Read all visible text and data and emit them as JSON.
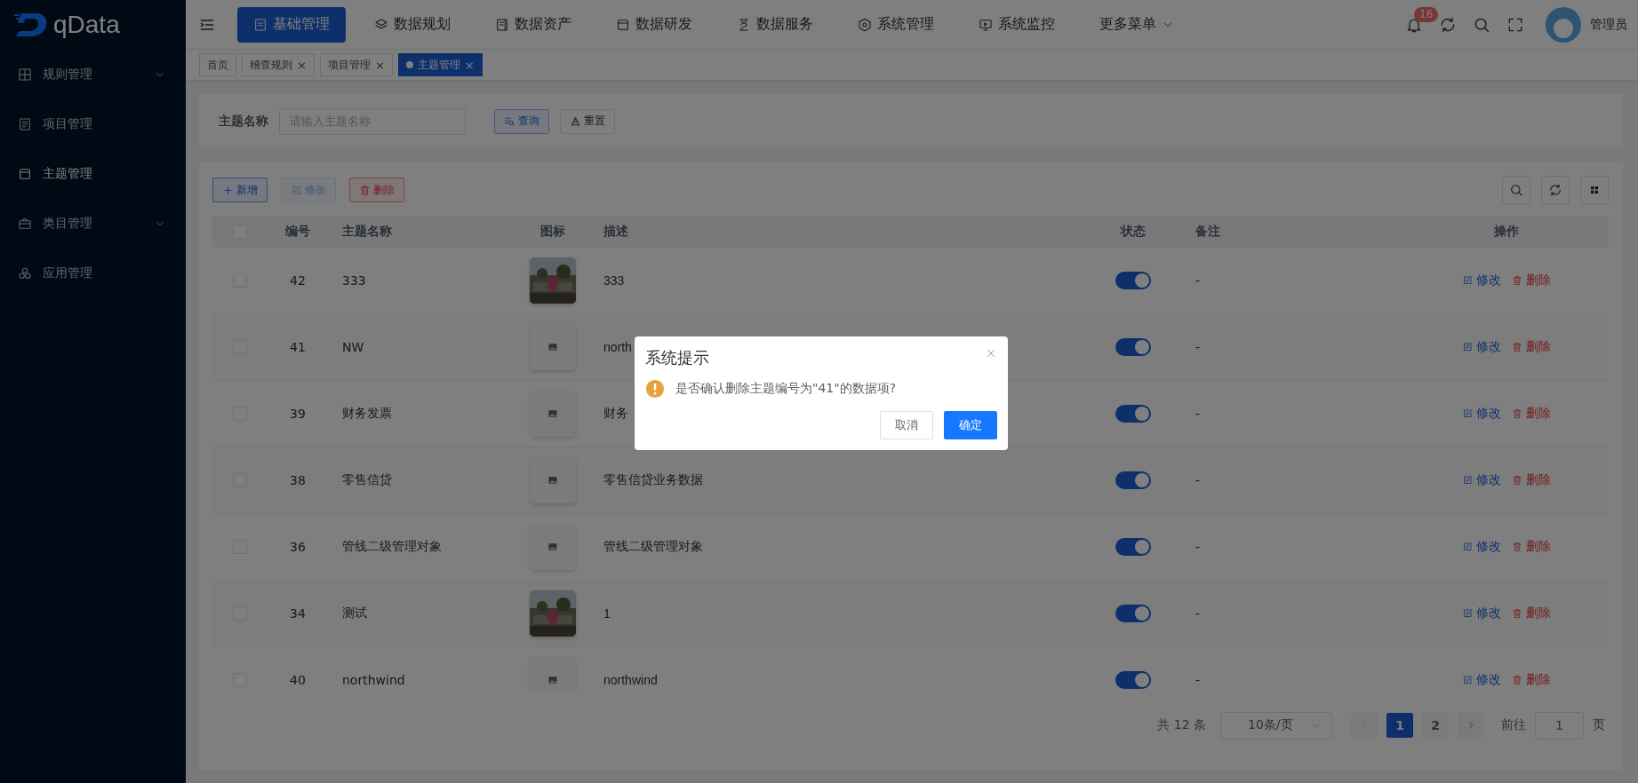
{
  "logo": {
    "text": "qData"
  },
  "top_menu": [
    {
      "label": "基础管理",
      "kind": "link",
      "selected": true
    },
    {
      "label": "数据规划",
      "kind": "link",
      "selected": false
    },
    {
      "label": "数据资产",
      "kind": "link",
      "selected": false
    },
    {
      "label": "数据研发",
      "kind": "link",
      "selected": false
    },
    {
      "label": "数据服务",
      "kind": "link",
      "selected": false
    },
    {
      "label": "系统管理",
      "kind": "link",
      "selected": false
    },
    {
      "label": "系统监控",
      "kind": "link",
      "selected": false
    },
    {
      "label": "更多菜单",
      "kind": "dropdown",
      "selected": false
    }
  ],
  "header": {
    "notification_count": "16",
    "user": "管理员"
  },
  "sidebar": {
    "items": [
      {
        "label": "规则管理",
        "expandable": true,
        "selected": false
      },
      {
        "label": "项目管理",
        "expandable": false,
        "selected": false
      },
      {
        "label": "主题管理",
        "expandable": false,
        "selected": true
      },
      {
        "label": "类目管理",
        "expandable": true,
        "selected": false
      },
      {
        "label": "应用管理",
        "expandable": false,
        "selected": false
      }
    ]
  },
  "tabs": [
    {
      "label": "首页",
      "closable": false,
      "selected": false
    },
    {
      "label": "稽查规则",
      "closable": true,
      "selected": false
    },
    {
      "label": "项目管理",
      "closable": true,
      "selected": false
    },
    {
      "label": "主题管理",
      "closable": true,
      "selected": true
    }
  ],
  "tab_close": "×",
  "search": {
    "label": "主题名称",
    "placeholder": "请输入主题名称",
    "query_button": "查询",
    "reset_button": "重置"
  },
  "toolbar": [
    {
      "label": "新增",
      "kind": "add",
      "disabled": false
    },
    {
      "label": "修改",
      "kind": "edit",
      "disabled": true
    },
    {
      "label": "删除",
      "kind": "delete",
      "disabled": false
    }
  ],
  "table": {
    "header_checked": false,
    "columns": [
      "编号",
      "主题名称",
      "图标",
      "描述",
      "状态",
      "备注",
      "操作"
    ],
    "rows": [
      {
        "checked": false,
        "id": "42",
        "name": "333",
        "kind": "picture",
        "description": "333",
        "on": true,
        "remark": "-",
        "edit_action": "修改",
        "delete_action": "删除"
      },
      {
        "checked": false,
        "id": "41",
        "name": "NW",
        "kind": "placeholder",
        "description": "north",
        "on": true,
        "remark": "-",
        "edit_action": "修改",
        "delete_action": "删除"
      },
      {
        "checked": false,
        "id": "39",
        "name": "财务发票",
        "kind": "placeholder",
        "description": "财务",
        "on": true,
        "remark": "-",
        "edit_action": "修改",
        "delete_action": "删除"
      },
      {
        "checked": false,
        "id": "38",
        "name": "零售信贷",
        "kind": "placeholder",
        "description": "零售信贷业务数据",
        "on": true,
        "remark": "-",
        "edit_action": "修改",
        "delete_action": "删除"
      },
      {
        "checked": false,
        "id": "36",
        "name": "管线二级管理对象",
        "kind": "placeholder",
        "description": "管线二级管理对象",
        "on": true,
        "remark": "-",
        "edit_action": "修改",
        "delete_action": "删除"
      },
      {
        "checked": false,
        "id": "34",
        "name": "测试",
        "kind": "picture",
        "description": "1",
        "on": true,
        "remark": "-",
        "edit_action": "修改",
        "delete_action": "删除"
      },
      {
        "checked": false,
        "id": "40",
        "name": "northwind",
        "kind": "placeholder",
        "description": "northwind",
        "on": true,
        "remark": "-",
        "edit_action": "修改",
        "delete_action": "删除"
      }
    ]
  },
  "pagination": {
    "total": "共 12 条",
    "page_size": "10条/页",
    "pages": [
      {
        "label": "1",
        "selected": true
      },
      {
        "label": "2",
        "selected": false
      }
    ],
    "goto_label": "前往",
    "goto_value": "1",
    "goto_suffix": "页"
  },
  "dialog": {
    "title": "系统提示",
    "message": "是否确认删除主题编号为\"41\"的数据项?",
    "cancel": "取消",
    "confirm": "确定"
  }
}
